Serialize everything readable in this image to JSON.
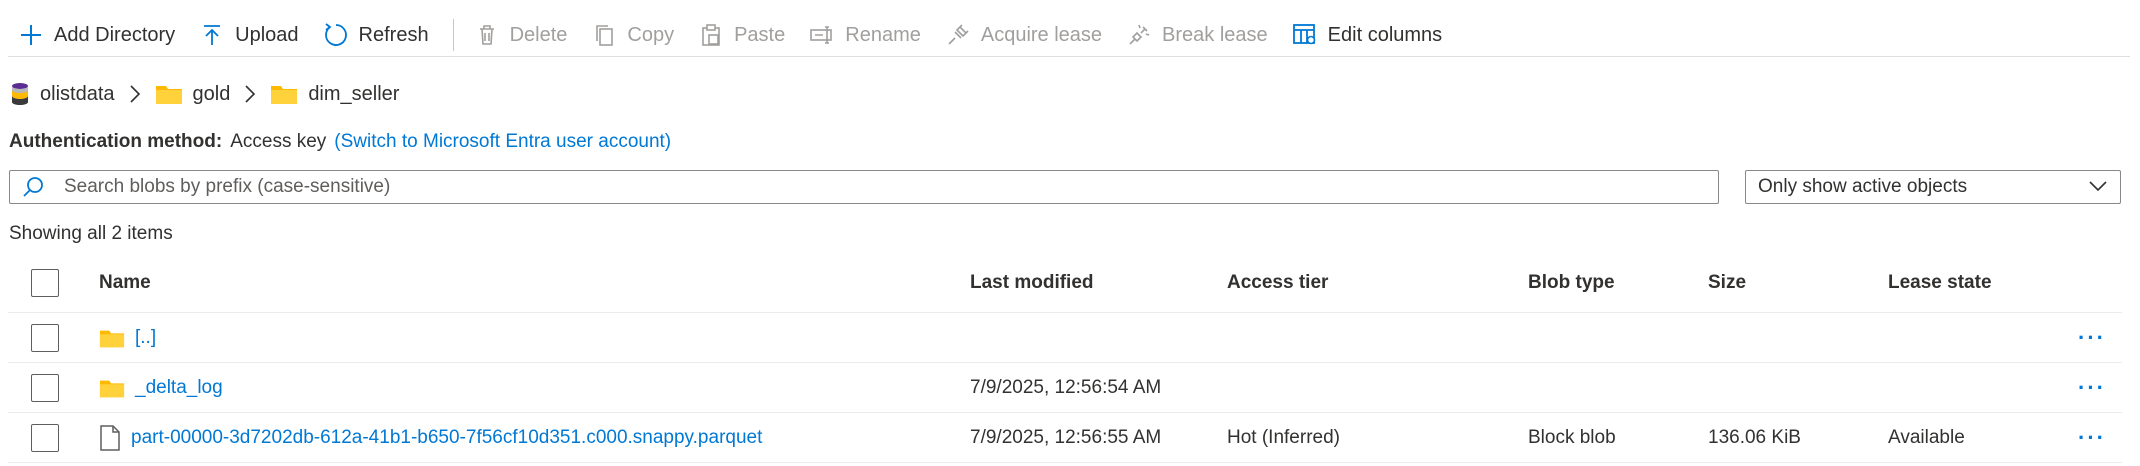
{
  "toolbar": {
    "add_directory": "Add Directory",
    "upload": "Upload",
    "refresh": "Refresh",
    "delete": "Delete",
    "copy": "Copy",
    "paste": "Paste",
    "rename": "Rename",
    "acquire_lease": "Acquire lease",
    "break_lease": "Break lease",
    "edit_columns": "Edit columns"
  },
  "breadcrumb": {
    "items": [
      "olistdata",
      "gold",
      "dim_seller"
    ]
  },
  "auth": {
    "label": "Authentication method:",
    "value": "Access key",
    "switch_link": "(Switch to Microsoft Entra user account)"
  },
  "search": {
    "placeholder": "Search blobs by prefix (case-sensitive)",
    "value": ""
  },
  "filter": {
    "selected": "Only show active objects"
  },
  "list": {
    "summary": "Showing all 2 items",
    "columns": {
      "name": "Name",
      "last_modified": "Last modified",
      "access_tier": "Access tier",
      "blob_type": "Blob type",
      "size": "Size",
      "lease_state": "Lease state"
    },
    "rows": [
      {
        "icon": "folder-icon",
        "name": "[..]",
        "last_modified": "",
        "access_tier": "",
        "blob_type": "",
        "size": "",
        "lease_state": "",
        "more": "···"
      },
      {
        "icon": "folder-icon",
        "name": "_delta_log",
        "last_modified": "7/9/2025, 12:56:54 AM",
        "access_tier": "",
        "blob_type": "",
        "size": "",
        "lease_state": "",
        "more": "···"
      },
      {
        "icon": "file-icon",
        "name": "part-00000-3d7202db-612a-41b1-b650-7f56cf10d351.c000.snappy.parquet",
        "last_modified": "7/9/2025, 12:56:55 AM",
        "access_tier": "Hot (Inferred)",
        "blob_type": "Block blob",
        "size": "136.06 KiB",
        "lease_state": "Available",
        "more": "···"
      }
    ]
  },
  "colors": {
    "accent": "#0078d4",
    "folder": "#ffb900",
    "disabled": "#a19f9d",
    "text": "#323130"
  }
}
